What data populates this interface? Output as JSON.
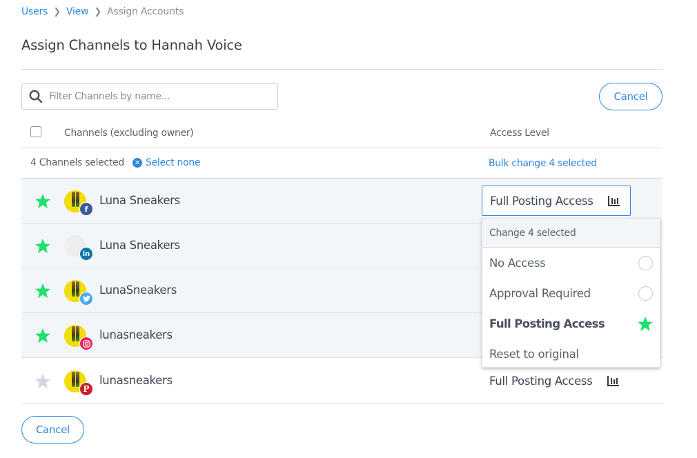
{
  "breadcrumb": {
    "items": [
      {
        "label": "Users"
      },
      {
        "label": "View"
      },
      {
        "label": "Assign Accounts"
      }
    ]
  },
  "page": {
    "title": "Assign Channels to Hannah Voice"
  },
  "search": {
    "placeholder": "Filter Channels by name...",
    "value": ""
  },
  "buttons": {
    "cancel_label": "Cancel"
  },
  "table": {
    "header": {
      "channels": "Channels (excluding owner)",
      "access": "Access Level"
    },
    "selection": {
      "count_number": "4",
      "count_text": "Channels selected",
      "select_none": "Select none",
      "bulk_prefix": "Bulk change",
      "bulk_number": "4",
      "bulk_suffix": "selected"
    },
    "rows": [
      {
        "name": "Luna Sneakers",
        "network": "facebook",
        "selected": true,
        "access": "Full Posting Access",
        "avatar": "photo"
      },
      {
        "name": "Luna Sneakers",
        "network": "linkedin",
        "selected": true,
        "access": "",
        "avatar": "blank"
      },
      {
        "name": "LunaSneakers",
        "network": "twitter",
        "selected": true,
        "access": "",
        "avatar": "photo"
      },
      {
        "name": "lunasneakers",
        "network": "instagram",
        "selected": true,
        "access": "",
        "avatar": "photo"
      },
      {
        "name": "lunasneakers",
        "network": "pinterest",
        "selected": false,
        "access": "Full Posting Access",
        "avatar": "photo"
      }
    ]
  },
  "dropdown": {
    "header_prefix": "Change",
    "header_number": "4",
    "header_suffix": "selected",
    "options": [
      {
        "label": "No Access",
        "state": "unchecked"
      },
      {
        "label": "Approval Required",
        "state": "unchecked"
      },
      {
        "label": "Full Posting Access",
        "state": "checked"
      },
      {
        "label": "Reset to original",
        "state": "none"
      }
    ]
  },
  "colors": {
    "accent": "#2b88e0",
    "star_selected": "#1ee06a",
    "star_unselected": "#cfd6de",
    "facebook": "#3b5998",
    "linkedin": "#0e76a8",
    "twitter": "#4aa8ec",
    "instagram": "#e8205a",
    "pinterest": "#cb1f27"
  }
}
